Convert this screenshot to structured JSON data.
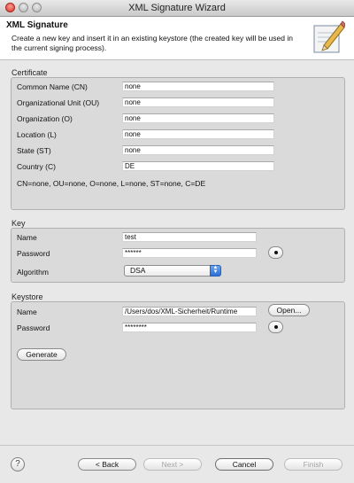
{
  "window": {
    "title": "XML Signature Wizard"
  },
  "header": {
    "title": "XML Signature",
    "description": "Create a new key and insert it in an existing keystore (the created key will be used in the current signing process)."
  },
  "certificate": {
    "group_label": "Certificate",
    "fields": [
      {
        "label": "Common Name (CN)",
        "value": "none"
      },
      {
        "label": "Organizational Unit (OU)",
        "value": "none"
      },
      {
        "label": "Organization (O)",
        "value": "none"
      },
      {
        "label": "Location (L)",
        "value": "none"
      },
      {
        "label": "State (ST)",
        "value": "none"
      },
      {
        "label": "Country (C)",
        "value": "DE"
      }
    ],
    "summary": "CN=none, OU=none, O=none, L=none, ST=none, C=DE"
  },
  "key": {
    "group_label": "Key",
    "name_label": "Name",
    "name_value": "test",
    "password_label": "Password",
    "password_value": "******",
    "algorithm_label": "Algorithm",
    "algorithm_value": "DSA"
  },
  "keystore": {
    "group_label": "Keystore",
    "name_label": "Name",
    "name_value": "/Users/dos/XML-Sicherheit/Runtime",
    "open_label": "Open...",
    "password_label": "Password",
    "password_value": "********",
    "generate_label": "Generate"
  },
  "footer": {
    "help_icon": "question-mark",
    "back_label": "< Back",
    "next_label": "Next >",
    "cancel_label": "Cancel",
    "finish_label": "Finish"
  }
}
